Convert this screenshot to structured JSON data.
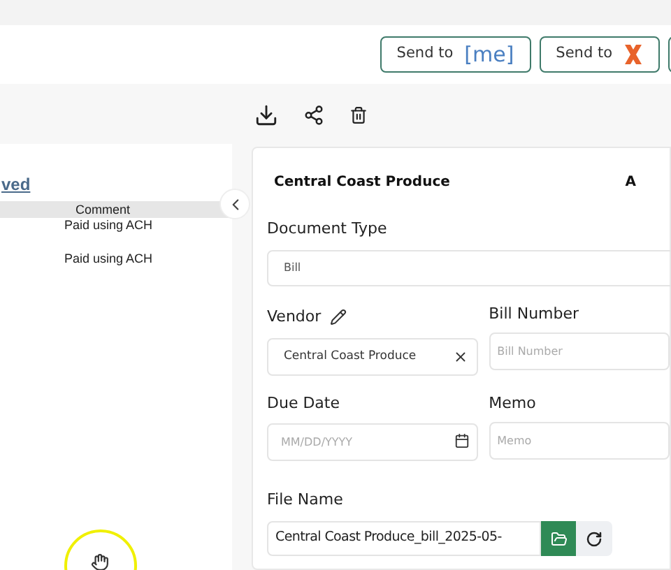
{
  "header": {
    "send_buttons": [
      {
        "label": "Send to",
        "kind": "me",
        "logo_text": "[me]"
      },
      {
        "label": "Send to",
        "kind": "x"
      }
    ]
  },
  "left_panel": {
    "link": "ved",
    "table": {
      "columns": [
        "Comment"
      ],
      "rows": [
        [
          "Paid using ACH"
        ],
        [
          "Paid using ACH"
        ]
      ]
    }
  },
  "form": {
    "title": "Central Coast Produce",
    "title_right": "A",
    "document_type": {
      "label": "Document Type",
      "value": "Bill"
    },
    "vendor": {
      "label": "Vendor",
      "value": "Central Coast Produce"
    },
    "bill_number": {
      "label": "Bill Number",
      "placeholder": "Bill Number"
    },
    "due_date": {
      "label": "Due Date",
      "placeholder": "MM/DD/YYYY"
    },
    "memo": {
      "label": "Memo",
      "placeholder": "Memo"
    },
    "file_name": {
      "label": "File Name",
      "value": "Central Coast Produce_bill_2025-05-"
    }
  }
}
